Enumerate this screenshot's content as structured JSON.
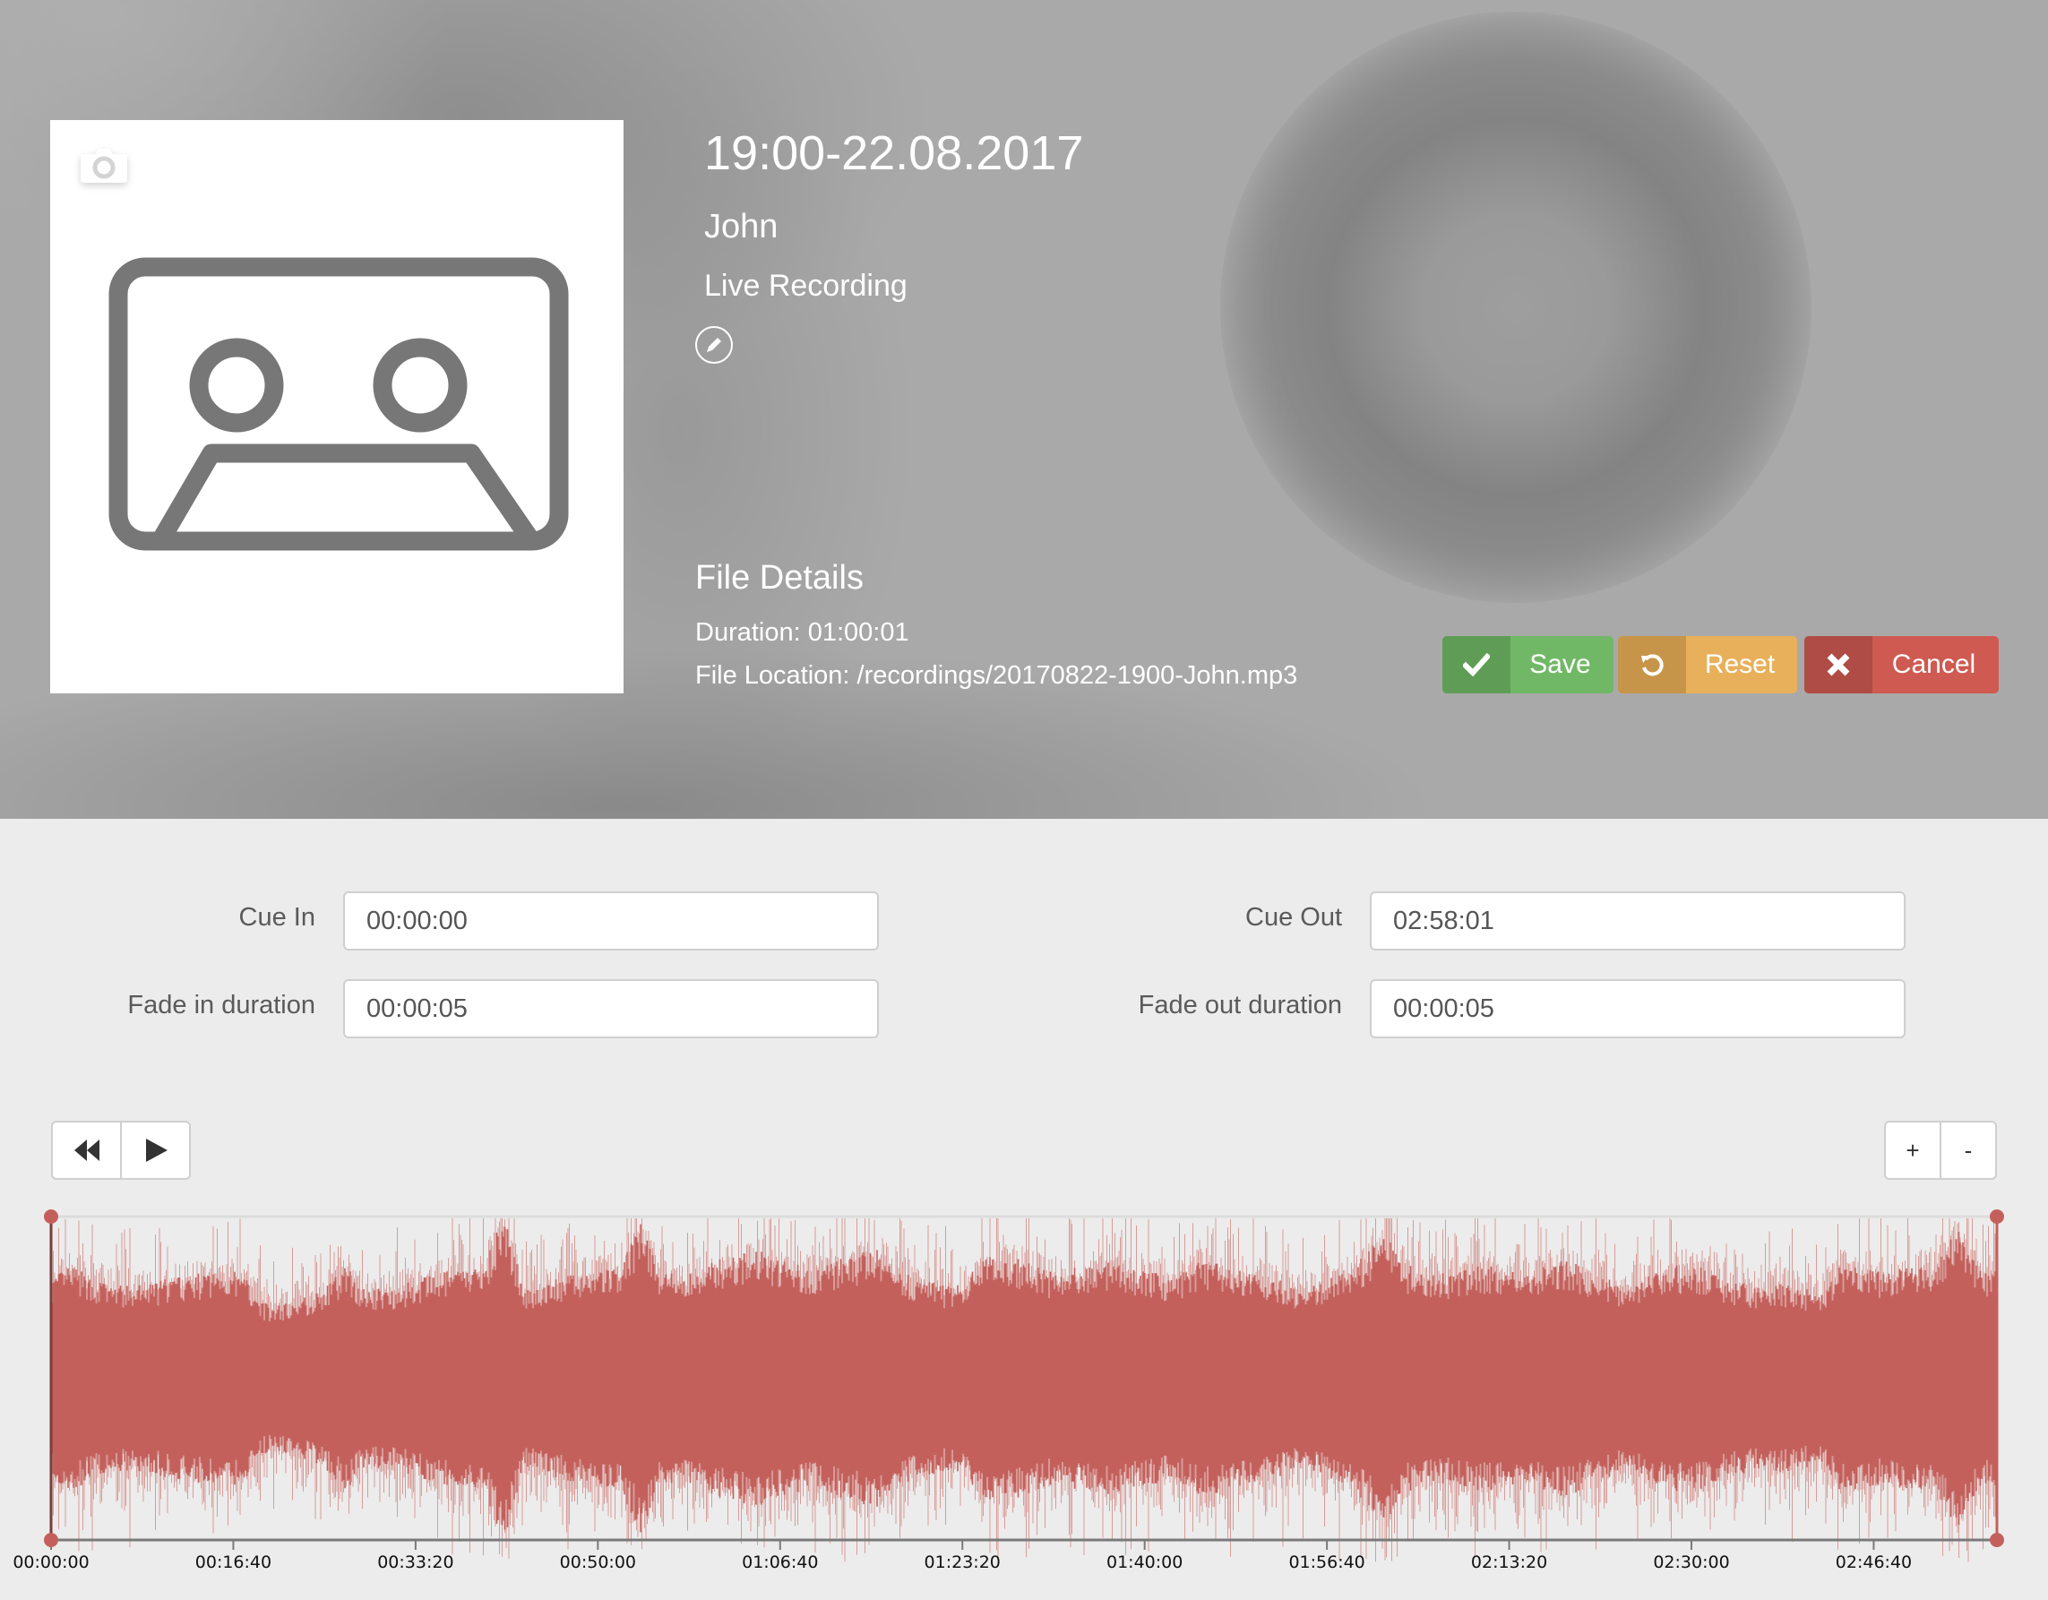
{
  "header": {
    "title": "19:00-22.08.2017",
    "artist": "John",
    "subtitle": "Live Recording",
    "edit_icon": "pencil-icon",
    "camera_icon": "camera-icon",
    "artwork_icon": "cassette-tape-icon",
    "file_details": {
      "heading": "File Details",
      "duration": "Duration: 01:00:01",
      "location": "File Location: /recordings/20170822-1900-John.mp3"
    }
  },
  "actions": {
    "save": {
      "label": "Save",
      "icon": "check-icon",
      "color": "#71b866"
    },
    "reset": {
      "label": "Reset",
      "icon": "undo-icon",
      "color": "#e8b05a"
    },
    "cancel": {
      "label": "Cancel",
      "icon": "close-icon",
      "color": "#cf5a51"
    }
  },
  "fields": {
    "cue_in": {
      "label": "Cue In",
      "value": "00:00:00"
    },
    "cue_out": {
      "label": "Cue Out",
      "value": "02:58:01"
    },
    "fade_in": {
      "label": "Fade in duration",
      "value": "00:00:05"
    },
    "fade_out": {
      "label": "Fade out duration",
      "value": "00:00:05"
    }
  },
  "player": {
    "rewind_icon": "rewind-icon",
    "play_icon": "play-icon",
    "zoom_in_label": "+",
    "zoom_out_label": "-"
  },
  "waveform": {
    "color": "#c4605c",
    "axis_labels": [
      "00:00:00",
      "00:16:40",
      "00:33:20",
      "00:50:00",
      "01:06:40",
      "01:23:20",
      "01:40:00",
      "01:56:40",
      "02:13:20",
      "02:30:00",
      "02:46:40"
    ],
    "tick_seconds": 1000,
    "total_seconds": 10681,
    "cue_in_seconds": 0,
    "cue_out_seconds": 10681,
    "envelope": [
      0.55,
      0.62,
      0.55,
      0.52,
      0.5,
      0.52,
      0.55,
      0.56,
      0.58,
      0.6,
      0.55,
      0.4,
      0.42,
      0.45,
      0.5,
      0.62,
      0.48,
      0.5,
      0.52,
      0.55,
      0.58,
      0.6,
      0.62,
      0.9,
      0.5,
      0.52,
      0.55,
      0.58,
      0.6,
      0.62,
      0.85,
      0.6,
      0.56,
      0.6,
      0.65,
      0.68,
      0.7,
      0.66,
      0.62,
      0.6,
      0.65,
      0.68,
      0.7,
      0.62,
      0.55,
      0.52,
      0.5,
      0.6,
      0.7,
      0.66,
      0.62,
      0.58,
      0.6,
      0.62,
      0.64,
      0.6,
      0.58,
      0.55,
      0.62,
      0.65,
      0.6,
      0.58,
      0.55,
      0.52,
      0.5,
      0.55,
      0.6,
      0.7,
      0.8,
      0.62,
      0.6,
      0.58,
      0.6,
      0.62,
      0.6,
      0.58,
      0.62,
      0.65,
      0.6,
      0.55,
      0.52,
      0.55,
      0.6,
      0.62,
      0.6,
      0.55,
      0.52,
      0.5,
      0.52,
      0.5,
      0.45,
      0.62,
      0.6,
      0.58,
      0.6,
      0.62,
      0.65,
      0.85,
      0.6,
      0.58
    ]
  }
}
